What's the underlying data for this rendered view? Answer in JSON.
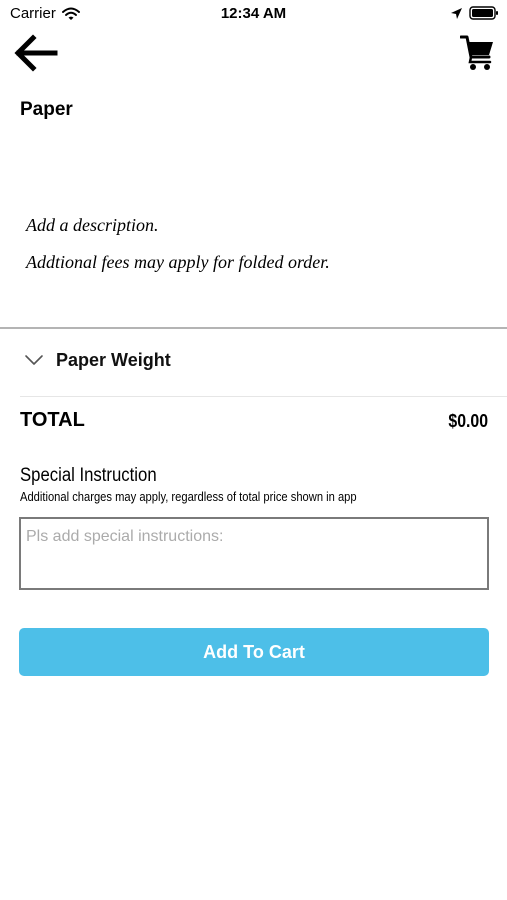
{
  "status_bar": {
    "carrier": "Carrier",
    "time": "12:34 AM",
    "icons": [
      "wifi-icon",
      "location-arrow-icon",
      "battery-icon"
    ]
  },
  "nav": {
    "back_icon": "arrow-left-icon",
    "cart_icon": "shopping-cart-icon"
  },
  "product": {
    "title": "Paper",
    "description_lines": [
      "Add a description.",
      "Addtional fees may apply for folded order."
    ]
  },
  "options": {
    "paper_weight_label": "Paper Weight",
    "expand_icon": "chevron-down-icon"
  },
  "total": {
    "label": "TOTAL",
    "value": "$0.00"
  },
  "special_instruction": {
    "title": "Special Instruction",
    "note": "Additional charges may apply, regardless of total price shown in app",
    "placeholder": "Pls add special instructions:",
    "value": ""
  },
  "actions": {
    "add_to_cart_label": "Add To Cart"
  },
  "colors": {
    "accent": "#4dbfe8",
    "background": "#ffffff",
    "text": "#000000",
    "placeholder": "#ababab",
    "input_border": "#7a7a7a",
    "divider": "#b4b4b4"
  }
}
